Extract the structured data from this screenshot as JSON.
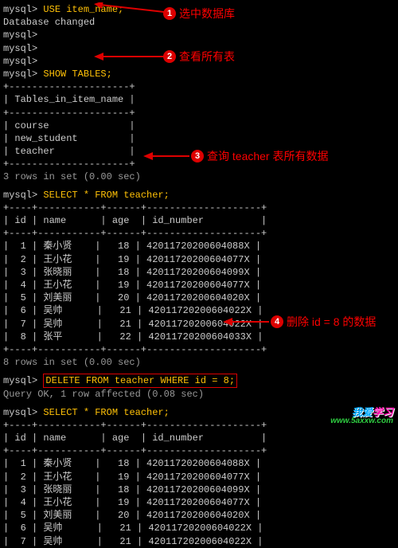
{
  "annotations": {
    "a1": {
      "num": "1",
      "text": "选中数据库"
    },
    "a2": {
      "num": "2",
      "text": "查看所有表"
    },
    "a3": {
      "num": "3",
      "text": "查询 teacher 表所有数据"
    },
    "a4": {
      "num": "4",
      "text": "删除 id = 8 的数据"
    }
  },
  "prompt": "mysql>",
  "blank_prompt": "mysql>",
  "cmd_use": "USE item_name;",
  "db_changed": "Database changed",
  "cmd_show": "SHOW TABLES;",
  "tables_header_sep": "+---------------------+",
  "tables_header": "| Tables_in_item_name |",
  "tables_rows": [
    "| course              |",
    "| new_student         |",
    "| teacher             |"
  ],
  "rows3": "3 rows in set (0.00 sec)",
  "cmd_select": "SELECT * FROM teacher;",
  "teacher_sep": "+----+-----------+------+--------------------+",
  "teacher_header": "| id | name      | age  | id_number          |",
  "teacher_rows": [
    "|  1 | 秦小贤    |   18 | 42011720200604088X |",
    "|  2 | 王小花    |   19 | 42011720200604077X |",
    "|  3 | 张晓丽    |   18 | 42011720200604099X |",
    "|  4 | 王小花    |   19 | 42011720200604077X |",
    "|  5 | 刘美丽    |   20 | 42011720200604020X |",
    "|  6 | 吴帅      |   21 | 42011720200604022X |",
    "|  7 | 吴帅      |   21 | 42011720200604022X |",
    "|  8 | 张平      |   22 | 42011720200604033X |"
  ],
  "rows8": "8 rows in set (0.00 sec)",
  "cmd_delete": "DELETE FROM teacher WHERE id = 8;",
  "query_ok": "Query OK, 1 row affected (0.08 sec)",
  "teacher2_rows": [
    "|  1 | 秦小贤    |   18 | 42011720200604088X |",
    "|  2 | 王小花    |   19 | 42011720200604077X |",
    "|  3 | 张晓丽    |   18 | 42011720200604099X |",
    "|  4 | 王小花    |   19 | 42011720200604077X |",
    "|  5 | 刘美丽    |   20 | 42011720200604020X |",
    "|  6 | 吴帅      |   21 | 42011720200604022X |",
    "|  7 | 吴帅      |   21 | 42011720200604022X |"
  ],
  "logo": {
    "cn": "我爱",
    "cn2": "学习",
    "url": "www.5axxw.com"
  }
}
